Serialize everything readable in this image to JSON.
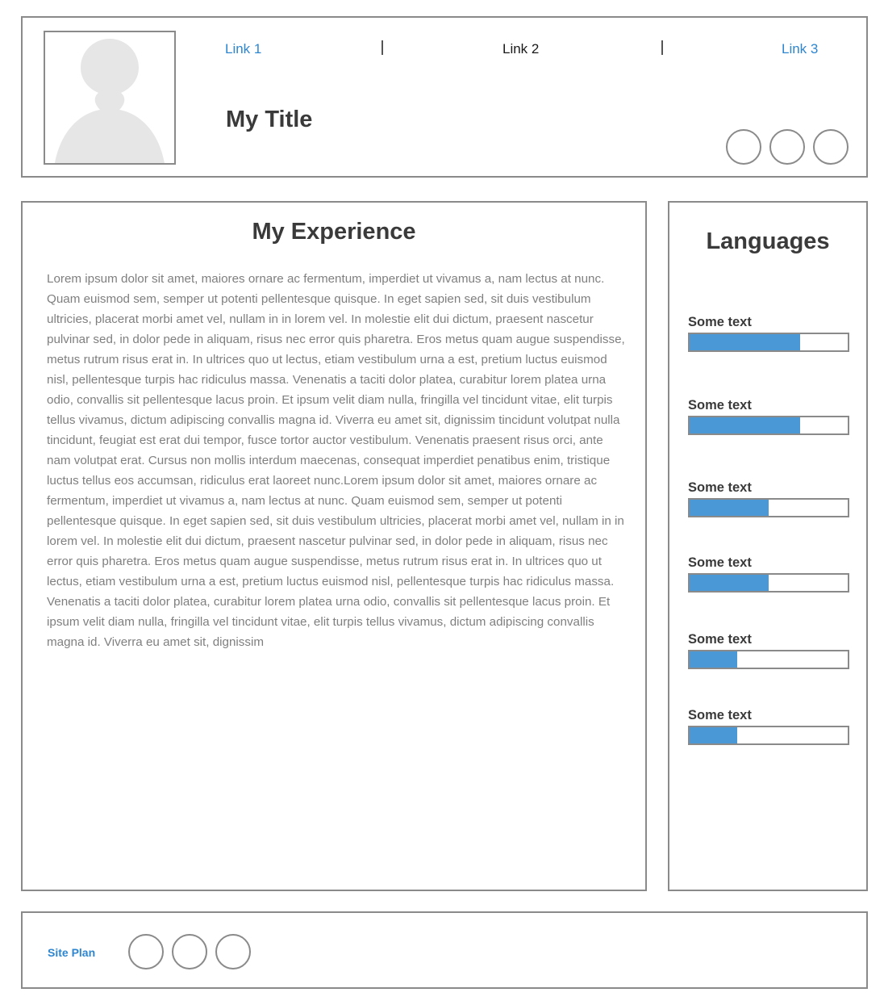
{
  "header": {
    "nav": {
      "link1": "Link 1",
      "link2": "Link 2",
      "link3": "Link 3"
    },
    "title": "My Title",
    "avatar_icon": "user-silhouette",
    "social_icons": [
      "circle-placeholder",
      "circle-placeholder",
      "circle-placeholder"
    ]
  },
  "experience": {
    "title": "My Experience",
    "body": "Lorem ipsum dolor sit amet, maiores ornare ac fermentum, imperdiet ut vivamus a, nam lectus at nunc. Quam euismod sem, semper ut potenti pellentesque quisque. In eget sapien sed, sit duis vestibulum ultricies, placerat morbi amet vel, nullam in in lorem vel. In molestie elit dui dictum, praesent nascetur pulvinar sed, in dolor pede in aliquam, risus nec error quis pharetra. Eros metus quam augue suspendisse, metus rutrum risus erat in.  In ultrices quo ut lectus, etiam vestibulum urna a est, pretium luctus euismod nisl, pellentesque turpis hac ridiculus massa. Venenatis a taciti dolor platea, curabitur lorem platea urna odio, convallis sit pellentesque lacus proin. Et ipsum velit diam nulla, fringilla vel tincidunt vitae, elit turpis tellus vivamus, dictum adipiscing convallis magna id. Viverra eu amet sit, dignissim tincidunt volutpat nulla tincidunt, feugiat est erat dui tempor, fusce tortor auctor vestibulum. Venenatis praesent risus orci, ante nam volutpat erat. Cursus non mollis interdum maecenas, consequat imperdiet penatibus enim, tristique luctus tellus eos accumsan, ridiculus erat laoreet nunc.Lorem ipsum dolor sit amet, maiores ornare ac fermentum, imperdiet ut vivamus a, nam lectus at nunc. Quam euismod sem, semper ut potenti pellentesque quisque. In eget sapien sed, sit duis vestibulum ultricies, placerat morbi amet vel, nullam in in lorem vel. In molestie elit dui dictum, praesent nascetur pulvinar sed, in dolor pede in aliquam, risus nec error quis pharetra. Eros metus quam augue suspendisse, metus rutrum risus erat in.  In ultrices quo ut lectus, etiam vestibulum urna a est, pretium luctus euismod nisl, pellentesque turpis hac ridiculus massa. Venenatis a taciti dolor platea, curabitur lorem platea urna odio, convallis sit pellentesque lacus proin. Et ipsum velit diam nulla, fringilla vel tincidunt vitae, elit turpis tellus vivamus, dictum adipiscing convallis magna id. Viverra eu amet sit, dignissim"
  },
  "languages": {
    "title": "Languages",
    "items": [
      {
        "label": "Some text",
        "level": 0.7
      },
      {
        "label": "Some text",
        "level": 0.7
      },
      {
        "label": "Some text",
        "level": 0.5
      },
      {
        "label": "Some text",
        "level": 0.5
      },
      {
        "label": "Some text",
        "level": 0.3
      },
      {
        "label": "Some text",
        "level": 0.3
      }
    ]
  },
  "footer": {
    "site_plan": "Site Plan",
    "social_icons": [
      "circle-placeholder",
      "circle-placeholder",
      "circle-placeholder"
    ]
  },
  "colors": {
    "accent": "#2e86d0",
    "bar_fill": "#4a98d6",
    "border": "#8a8a8a",
    "heading": "#3a3a3a",
    "body_text": "#7f7f7f"
  }
}
